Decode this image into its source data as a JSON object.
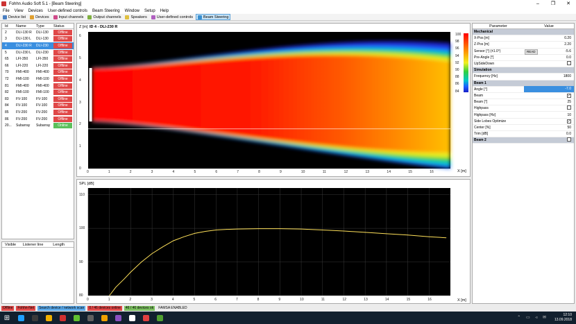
{
  "window": {
    "title": "Fohhn Audio Soft 5.1 - [Beam Steering]",
    "min": "–",
    "max": "❐",
    "close": "✕"
  },
  "menu": [
    "File",
    "View",
    "Devices",
    "User-defined controls",
    "Beam Steering",
    "Window",
    "Setup",
    "Help"
  ],
  "toolbar": [
    {
      "label": "Device list",
      "color": "#4a7fc1",
      "active": false
    },
    {
      "label": "Devices",
      "color": "#e0a030",
      "active": false
    },
    {
      "label": "Input channels",
      "color": "#d04a8a",
      "active": false
    },
    {
      "label": "Output channels",
      "color": "#7fb040",
      "active": false
    },
    {
      "label": "Speakers",
      "color": "#e0c040",
      "active": false
    },
    {
      "label": "User-defined controls",
      "color": "#b060c0",
      "active": false
    },
    {
      "label": "Beam Steering",
      "color": "#3a90d0",
      "active": true
    }
  ],
  "devices": {
    "headers": {
      "id": "Id",
      "name": "Name",
      "type": "Type",
      "status": "Status"
    },
    "rows": [
      {
        "id": "2",
        "name": "DLI-130 R",
        "type": "DLI-130",
        "status": "Offline",
        "selected": false
      },
      {
        "id": "3",
        "name": "DLI-130 L",
        "type": "DLI-130",
        "status": "Offline",
        "selected": false
      },
      {
        "id": "4",
        "name": "DLI-230 R",
        "type": "DLI-230",
        "status": "Offline",
        "selected": true
      },
      {
        "id": "5",
        "name": "DLI-230 L",
        "type": "DLI-230",
        "status": "Offline",
        "selected": false
      },
      {
        "id": "65",
        "name": "LFI-350",
        "type": "LFI-350",
        "status": "Offline",
        "selected": false
      },
      {
        "id": "66",
        "name": "LFI-220",
        "type": "LFI-220",
        "status": "Offline",
        "selected": false
      },
      {
        "id": "70",
        "name": "FMI-400",
        "type": "FMI-400",
        "status": "Offline",
        "selected": false
      },
      {
        "id": "72",
        "name": "FMI-100",
        "type": "FMI-100",
        "status": "Offline",
        "selected": false
      },
      {
        "id": "81",
        "name": "FMI-400",
        "type": "FMI-400",
        "status": "Offline",
        "selected": false
      },
      {
        "id": "82",
        "name": "FMI-100",
        "type": "FMI-100",
        "status": "Offline",
        "selected": false
      },
      {
        "id": "83",
        "name": "FV-100",
        "type": "FV-100",
        "status": "Offline",
        "selected": false
      },
      {
        "id": "84",
        "name": "FV-100",
        "type": "FV-100",
        "status": "Offline",
        "selected": false
      },
      {
        "id": "85",
        "name": "FV-200",
        "type": "FV-200",
        "status": "Offline",
        "selected": false
      },
      {
        "id": "86",
        "name": "FV-200",
        "type": "FV-200",
        "status": "Offline",
        "selected": false
      },
      {
        "id": "20...",
        "name": "Subarray",
        "type": "Subarray",
        "status": "Online",
        "selected": false
      }
    ]
  },
  "listeners": {
    "headers": {
      "visible": "Visible",
      "line": "Listener line",
      "length": "Length"
    }
  },
  "beam_plot": {
    "title": "ID 4 - DLI-230 R",
    "ylabel": "Z [m]",
    "xlabel": "X [m]",
    "yticks": [
      "0",
      "1",
      "2",
      "3",
      "4",
      "5",
      "6"
    ],
    "xticks": [
      "0",
      "1",
      "2",
      "3",
      "4",
      "5",
      "6",
      "7",
      "8",
      "9",
      "10",
      "11",
      "12",
      "13",
      "14",
      "15",
      "16"
    ],
    "scale": [
      "100",
      "98",
      "96",
      "94",
      "92",
      "90",
      "88",
      "86",
      "84"
    ],
    "listener_height_m": 1.8,
    "array_bottom_m": 2.2,
    "array_top_m": 4.5
  },
  "chart_data": {
    "type": "line",
    "xlabel": "X [m]",
    "ylabel": "SPL [dB]",
    "xlim": [
      0,
      17
    ],
    "ylim": [
      80,
      112
    ],
    "xticks": [
      "0",
      "1",
      "2",
      "3",
      "4",
      "5",
      "6",
      "7",
      "8",
      "9",
      "10",
      "11",
      "12",
      "13",
      "14",
      "15",
      "16"
    ],
    "yticks": [
      "80",
      "90",
      "100",
      "110"
    ],
    "grid": true,
    "series": [
      {
        "color": "#ffe15a",
        "x": [
          1.0,
          1.3,
          1.7,
          2.0,
          2.5,
          3.0,
          3.5,
          4.0,
          4.5,
          5.0,
          5.5,
          6.0,
          6.5,
          7.0,
          8.0,
          9.0,
          10.0,
          11.0,
          12.0,
          13.0,
          14.0,
          15.0,
          16.0,
          16.8
        ],
        "y": [
          80.0,
          82.5,
          85.0,
          87.0,
          90.0,
          92.5,
          94.5,
          96.3,
          97.5,
          98.5,
          99.1,
          99.5,
          99.7,
          99.8,
          99.9,
          99.9,
          99.8,
          99.5,
          99.2,
          98.8,
          98.4,
          98.0,
          97.5,
          97.2
        ]
      }
    ]
  },
  "parameters": {
    "headers": {
      "param": "Parameter",
      "value": "Value"
    },
    "rows": [
      {
        "kind": "section",
        "name": "Mechanical",
        "value": ""
      },
      {
        "kind": "text",
        "name": "X-Pos [m]",
        "value": "0.20"
      },
      {
        "kind": "text",
        "name": "Z-Pos [m]",
        "value": "2.20"
      },
      {
        "kind": "text",
        "name": "Sensor [°] (±1.0°)",
        "value": "-5.6",
        "badge": "READ"
      },
      {
        "kind": "text",
        "name": "Pre-Angle [°]",
        "value": "0.0"
      },
      {
        "kind": "check",
        "name": "UpSideDown",
        "value": ""
      },
      {
        "kind": "section",
        "name": "Simulation",
        "value": ""
      },
      {
        "kind": "text",
        "name": "Frequency [Hz]",
        "value": "1800"
      },
      {
        "kind": "section",
        "name": "Beam 1",
        "value": ""
      },
      {
        "kind": "text",
        "name": "Angle [°]",
        "value": "-7.0",
        "highlight": true
      },
      {
        "kind": "check",
        "name": "Beam",
        "value": "✓"
      },
      {
        "kind": "text",
        "name": "Beam [°]",
        "value": "25"
      },
      {
        "kind": "check",
        "name": "Highpass",
        "value": ""
      },
      {
        "kind": "text",
        "name": "Highpass [Hz]",
        "value": "10"
      },
      {
        "kind": "check",
        "name": "Side Lobes Optimize",
        "value": "✓"
      },
      {
        "kind": "text",
        "name": "Center [%]",
        "value": "50"
      },
      {
        "kind": "text",
        "name": "Trim [dB]",
        "value": "0.0"
      },
      {
        "kind": "section-check",
        "name": "Beam 2",
        "value": ""
      }
    ]
  },
  "statusbar": [
    {
      "label": "Offline",
      "color": "#e04848"
    },
    {
      "label": "Fohhn-Net",
      "color": "#e04848"
    },
    {
      "label": "Search device / network scan",
      "color": "#5aa8e8"
    },
    {
      "label": "0 / 46 devices online",
      "color": "#e04848"
    },
    {
      "label": "46 / 46 devices ok",
      "color": "#7cc060"
    },
    {
      "label": "FAMSA ENABLED",
      "color": ""
    }
  ],
  "taskbar": {
    "apps": [
      "#1ea0ff",
      "#3a3a3a",
      "#f0b000",
      "#d03030",
      "#60c030",
      "#606060",
      "#f0a000",
      "#8a50c0",
      "#ffffff",
      "#e04040",
      "#50a030"
    ],
    "time": "12:10",
    "date": "13.09.2018"
  }
}
